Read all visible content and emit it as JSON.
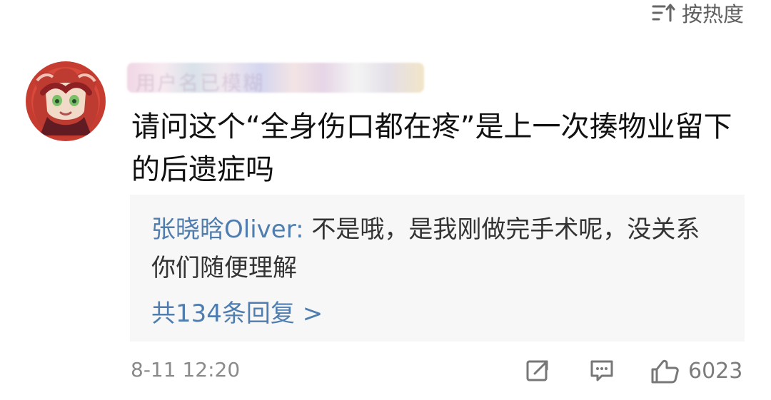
{
  "sort": {
    "icon": "sort-icon",
    "label": "按热度"
  },
  "comment": {
    "avatar": "avatar",
    "username_redacted": "用户名已模糊",
    "text": "请问这个“全身伤口都在疼”是上一次揍物业留下的后遗症吗"
  },
  "reply": {
    "author": "张晓晗Oliver:",
    "text": " 不是哦，是我刚做完手术呢，没关系你们随便理解",
    "count_label": "共134条回复 >"
  },
  "meta": {
    "time": "8-11 12:20",
    "share_icon": "share-icon",
    "comment_icon": "comment-icon",
    "like_icon": "like-icon",
    "like_count": "6023"
  },
  "colors": {
    "reply_link": "#507daf",
    "text_primary": "#111111",
    "text_secondary": "#8a8a8a",
    "reply_bg": "#f7f7f7"
  }
}
